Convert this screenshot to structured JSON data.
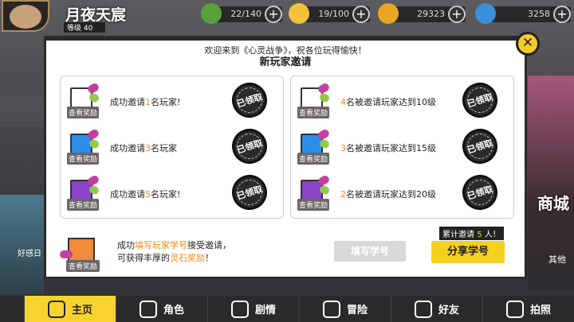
{
  "topbar": {
    "player_name": "月夜天宸",
    "level": "等级 40",
    "stamina": "22/140",
    "energy": "19/100",
    "gold": "29323",
    "diamond": "3258"
  },
  "side": {
    "left_label": "好感日",
    "shop_label": "商城",
    "other_label": "其他"
  },
  "modal": {
    "welcome": "欢迎来到《心灵战争》，祝各位玩得愉快！",
    "title": "新玩家邀请",
    "view_reward": "查看奖励",
    "claimed": "已领取",
    "left_rows": [
      {
        "pre": "成功邀请",
        "n": "1",
        "post": "名玩家!",
        "box_color": "#ffffff"
      },
      {
        "pre": "成功邀请",
        "n": "3",
        "post": "名玩家",
        "box_color": "#2b8de8"
      },
      {
        "pre": "成功邀请",
        "n": "5",
        "post": "名玩家!",
        "box_color": "#8a43c9"
      }
    ],
    "right_rows": [
      {
        "pre": "",
        "n": "4",
        "post": "名被邀请玩家达到10级",
        "box_color": "#ffffff"
      },
      {
        "pre": "",
        "n": "3",
        "post": "名被邀请玩家达到15级",
        "box_color": "#2b8de8"
      },
      {
        "pre": "",
        "n": "2",
        "post": "名被邀请玩家达到20级",
        "box_color": "#8a43c9"
      }
    ],
    "desc_1_pre": "成功",
    "desc_1_hl": "填写玩家学号",
    "desc_1_post": "接受邀请，",
    "desc_2_pre": "可获得丰厚的",
    "desc_2_hl": "灵石奖励",
    "desc_2_post": "！",
    "count_pre": "累计邀请",
    "count_n": "5",
    "count_post": "人！",
    "fill_btn": "填写学号",
    "share_btn": "分享学号"
  },
  "nav": [
    {
      "label": "主页"
    },
    {
      "label": "角色"
    },
    {
      "label": "剧情"
    },
    {
      "label": "冒险"
    },
    {
      "label": "好友"
    },
    {
      "label": "拍照"
    }
  ]
}
